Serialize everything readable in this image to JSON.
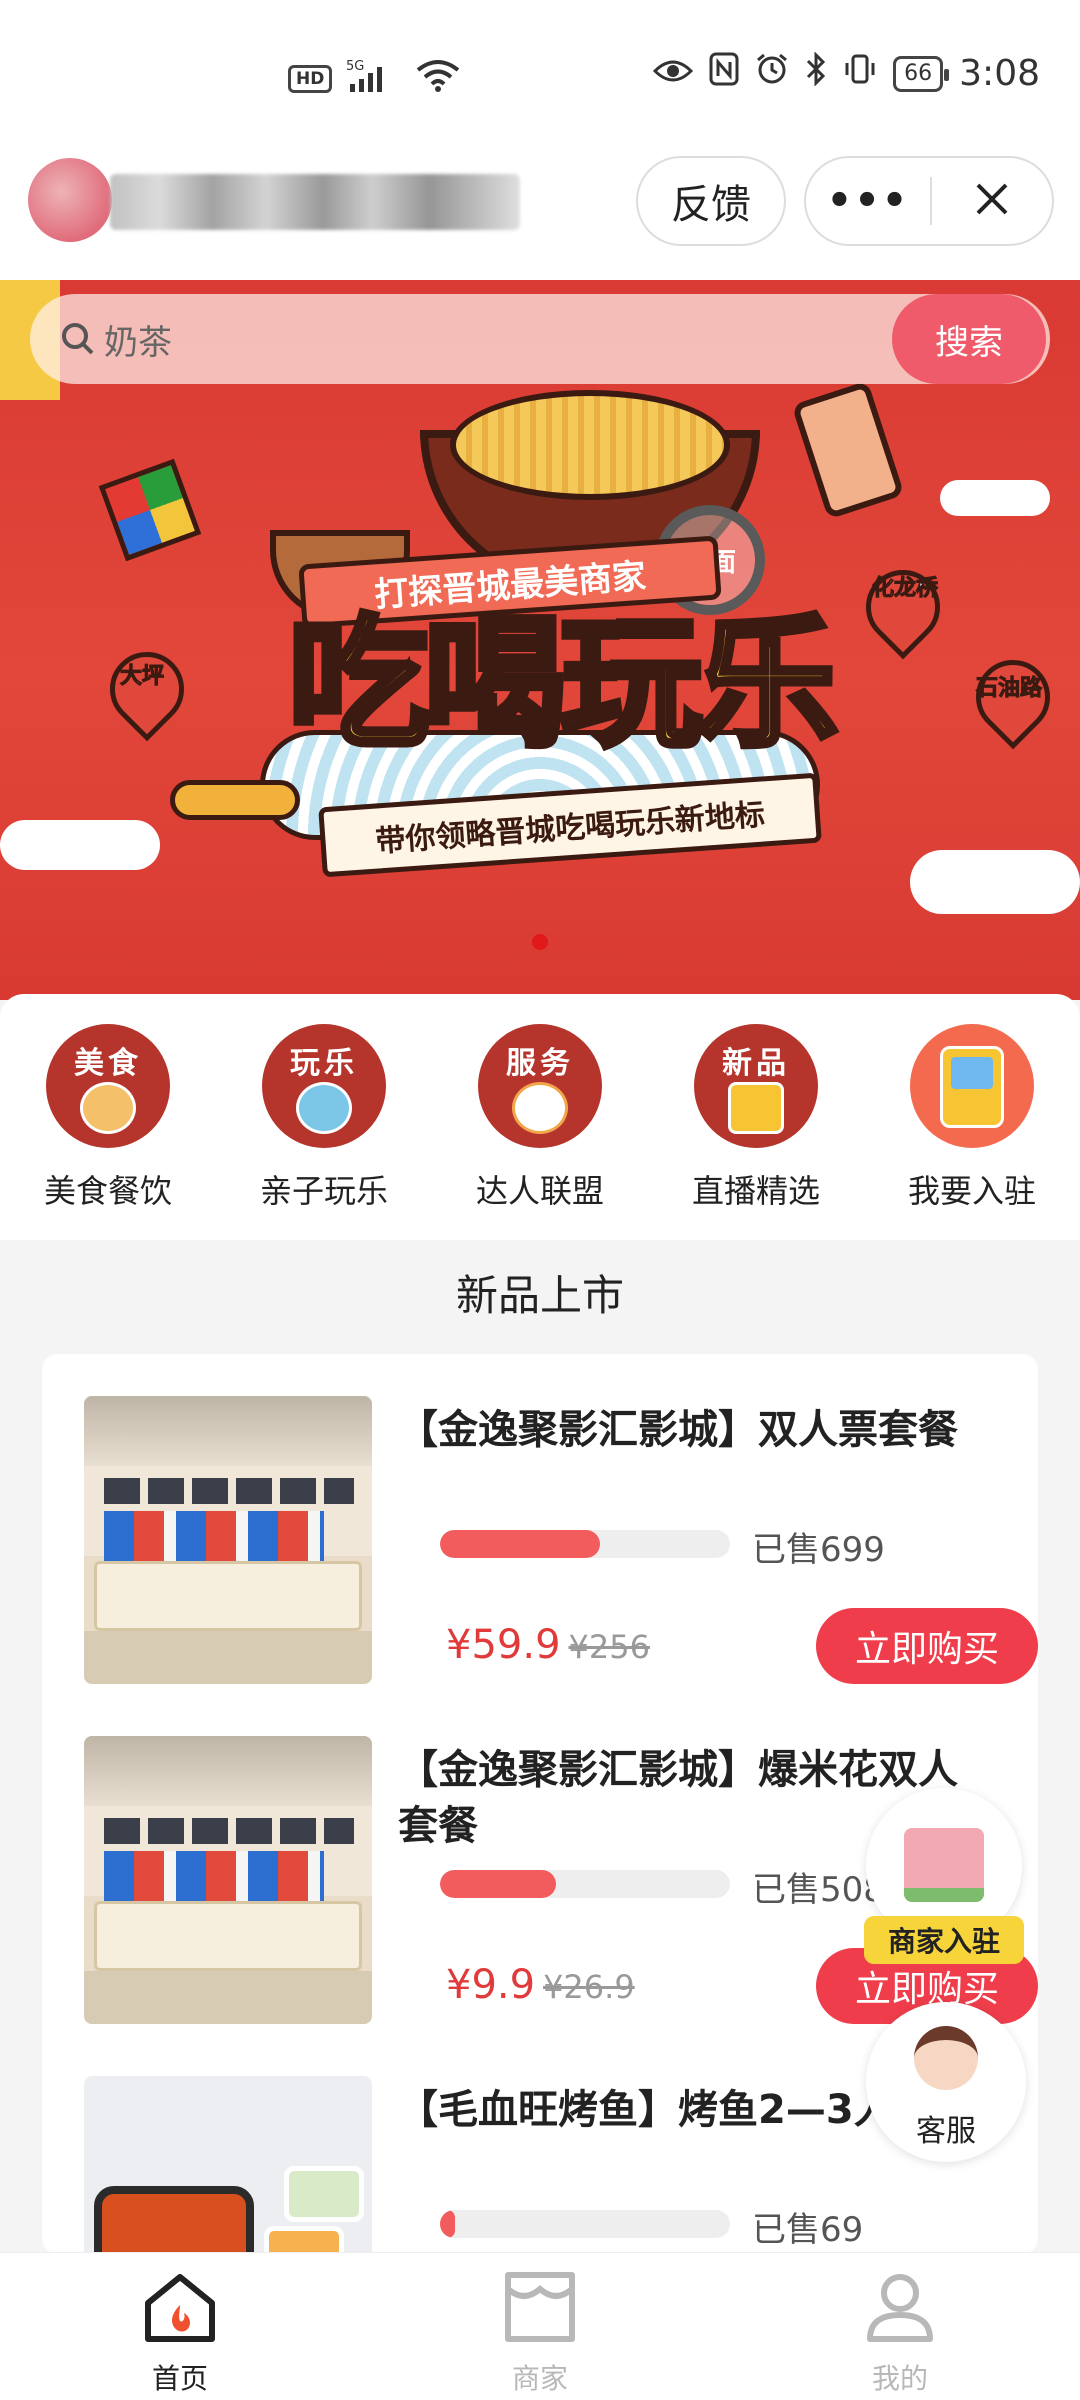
{
  "status_bar": {
    "network_badge": "HD",
    "signal_label": "5G",
    "battery": "66",
    "time": "3:08"
  },
  "nav": {
    "feedback_label": "反馈",
    "more_label": "•••"
  },
  "search": {
    "placeholder": "奶茶",
    "button_label": "搜索"
  },
  "banner": {
    "top_ribbon": "打探晋城最美商家",
    "headline": "吃喝玩乐",
    "subline": "带你领略晋城吃喝玩乐新地标",
    "pins": [
      "大坪",
      "化龙桥",
      "石油路"
    ],
    "magnifier_text": "拉面",
    "active_dot": 1
  },
  "categories": [
    {
      "label": "美食餐饮",
      "icon_word": "美食",
      "icon": "food-icon"
    },
    {
      "label": "亲子玩乐",
      "icon_word": "玩乐",
      "icon": "family-play-icon"
    },
    {
      "label": "达人联盟",
      "icon_word": "服务",
      "icon": "service-icon"
    },
    {
      "label": "直播精选",
      "icon_word": "新品",
      "icon": "new-product-icon"
    },
    {
      "label": "我要入驻",
      "icon_word": "",
      "icon": "game-console-icon"
    }
  ],
  "section": {
    "title": "新品上市"
  },
  "products": [
    {
      "title": "【金逸聚影汇影城】双人票套餐",
      "sold": "已售699",
      "sold_ratio": 0.55,
      "price": "¥59.9",
      "original_price": "¥256",
      "buy_label": "立即购买"
    },
    {
      "title": "【金逸聚影汇影城】爆米花双人套餐",
      "sold": "已售508",
      "sold_ratio": 0.4,
      "price": "¥9.9",
      "original_price": "¥26.9",
      "buy_label": "立即购买"
    },
    {
      "title": "【毛血旺烤鱼】烤鱼2—3人",
      "sold": "已售69",
      "sold_ratio": 0.05
    }
  ],
  "floating": {
    "merchant_label": "商家入驻",
    "service_label": "客服"
  },
  "tabbar": {
    "tabs": [
      {
        "label": "首页",
        "active": true
      },
      {
        "label": "商家",
        "active": false
      },
      {
        "label": "我的",
        "active": false
      }
    ],
    "active_color": "#222222",
    "inactive_color": "#b8b8b8",
    "home_icon_accent": "#f0502f"
  },
  "colors": {
    "accent_red": "#ef3d4b",
    "price_red": "#e03a3a",
    "banner_red": "#d93a33"
  }
}
